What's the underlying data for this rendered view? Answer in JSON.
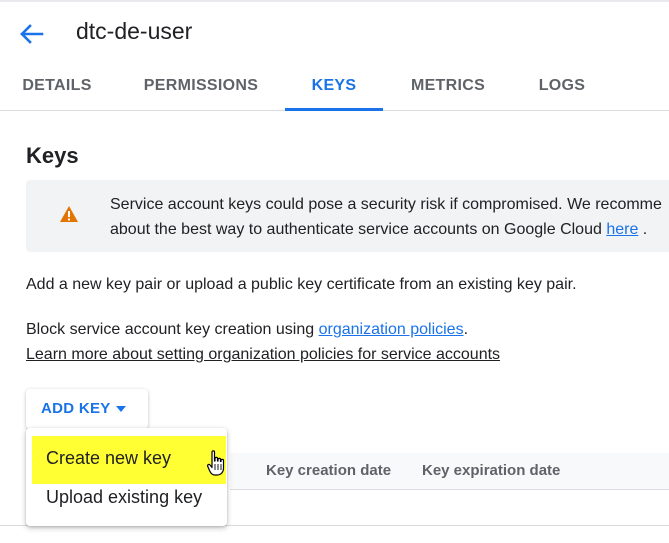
{
  "header": {
    "title": "dtc-de-user"
  },
  "tabs": [
    {
      "label": "DETAILS"
    },
    {
      "label": "PERMISSIONS"
    },
    {
      "label": "KEYS"
    },
    {
      "label": "METRICS"
    },
    {
      "label": "LOGS"
    }
  ],
  "active_tab": "KEYS",
  "section": {
    "title": "Keys"
  },
  "warning": {
    "line1": "Service account keys could pose a security risk if compromised. We recomme",
    "line2_prefix": "about the best way to authenticate service accounts on Google Cloud ",
    "link": "here",
    "line2_suffix": " ."
  },
  "intro_text": "Add a new key pair or upload a public key certificate from an existing key pair.",
  "policy": {
    "prefix": "Block service account key creation using ",
    "link": "organization policies",
    "suffix": ".",
    "learn_more": "Learn more about setting organization policies for service accounts"
  },
  "add_key": {
    "label": "ADD KEY"
  },
  "dropdown": {
    "items": [
      {
        "label": "Create new key",
        "highlighted": true
      },
      {
        "label": "Upload existing key",
        "highlighted": false
      }
    ]
  },
  "table": {
    "columns": [
      "Key creation date",
      "Key expiration date"
    ]
  },
  "colors": {
    "accent": "#1a73e8",
    "warning_icon": "#e37400",
    "highlight": "#ffff33"
  },
  "icons": {
    "back": "arrow-left",
    "warning": "warning-triangle",
    "caret": "caret-down",
    "cursor": "hand-pointer"
  }
}
